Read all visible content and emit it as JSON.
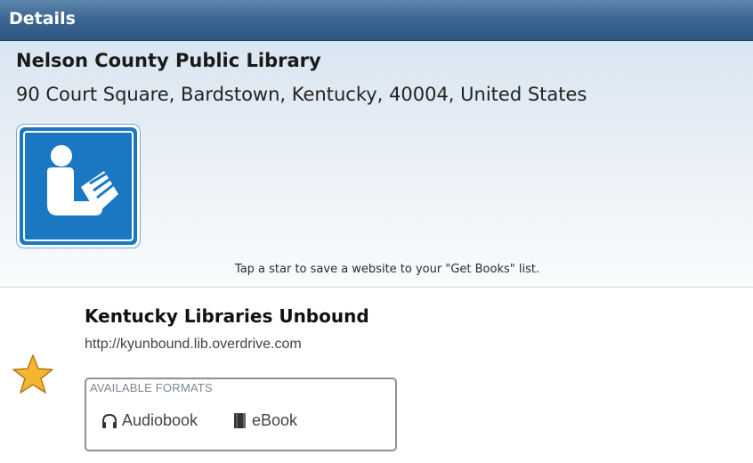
{
  "window": {
    "title": "Details"
  },
  "library": {
    "name": "Nelson County Public Library",
    "address": "90 Court Square, Bardstown, Kentucky, 40004, United States"
  },
  "hint": "Tap a star to save a website to your \"Get Books\" list.",
  "website": {
    "name": "Kentucky Libraries Unbound",
    "url": "http://kyunbound.lib.overdrive.com",
    "starred": true,
    "formats_label": "AVAILABLE FORMATS",
    "formats": [
      {
        "label": "Audiobook",
        "icon": "headphones-icon"
      },
      {
        "label": "eBook",
        "icon": "book-icon"
      }
    ]
  },
  "colors": {
    "titlebar": "#3d6894",
    "logo_blue": "#1a78c2",
    "star": "#f4b531"
  }
}
